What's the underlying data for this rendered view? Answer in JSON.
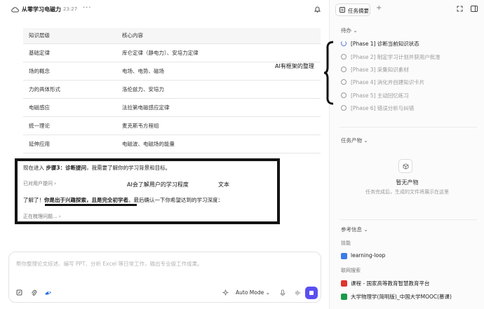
{
  "header": {
    "title": "从零学习电磁力",
    "time": "23:27",
    "more_label": "···"
  },
  "table": {
    "headers": [
      "知识层级",
      "核心内容"
    ],
    "rows": [
      [
        "基础定律",
        "库仑定律（静电力）、安培力定律"
      ],
      [
        "场的概念",
        "电场、电势、磁场"
      ],
      [
        "力的具体形式",
        "洛伦兹力、安培力"
      ],
      [
        "电磁感应",
        "法拉第电磁感应定律"
      ],
      [
        "统一理论",
        "麦克斯韦方程组"
      ],
      [
        "延伸应用",
        "电磁波、电磁场的能量"
      ]
    ]
  },
  "chat": {
    "step_prefix": "现在进入 ",
    "step_bold": "步骤3：诊断提问",
    "step_suffix": "，我需要了解你的学习背景和目标。",
    "used_tool": "已对用户提问",
    "reply_prefix": "了解了！",
    "reply_bold": "你是出于兴趣探索，且是完全初学者",
    "reply_suffix": "。最后确认一下你希望达到的学习深度：",
    "thinking": "正在梳理问题..."
  },
  "annotations": {
    "user_level": "AI会了解用户的学习程度",
    "text": "文本",
    "framework": "AI有框架的整理"
  },
  "composer": {
    "placeholder": "帮你整理论文综述、编写 PPT、分析 Excel 等日常工作，输出专业级工作成果。",
    "mode": "Auto Mode"
  },
  "right": {
    "tab_label": "任务摘要",
    "todo_title": "待办",
    "todos": [
      {
        "label": "[Phase 1] 诊断当前知识状态",
        "active": true
      },
      {
        "label": "[Phase 2] 制定学习计划并获用户批准",
        "active": false
      },
      {
        "label": "[Phase 3] 采集知识素材",
        "active": false
      },
      {
        "label": "[Phase 4] 消化并创建知识卡片",
        "active": false
      },
      {
        "label": "[Phase 5] 主动回忆练习",
        "active": false
      },
      {
        "label": "[Phase 6] 错误分析与纠错",
        "active": false
      }
    ],
    "artifacts_title": "任务产物",
    "empty_title": "暂无产物",
    "empty_desc": "任务完成后，生成的文件将展示在这里",
    "refs_title": "参考信息",
    "skills_label": "技能",
    "skill_item": "learning-loop",
    "search_label": "联网搜索",
    "search_items": [
      "课程 - 国家高等教育智慧教育平台",
      "大学物理学(简明版)_中国大学MOOC(慕课)"
    ],
    "colors": {
      "accent": "#5b4ff2",
      "active_todo_spinner": "#5b7fd6"
    }
  }
}
